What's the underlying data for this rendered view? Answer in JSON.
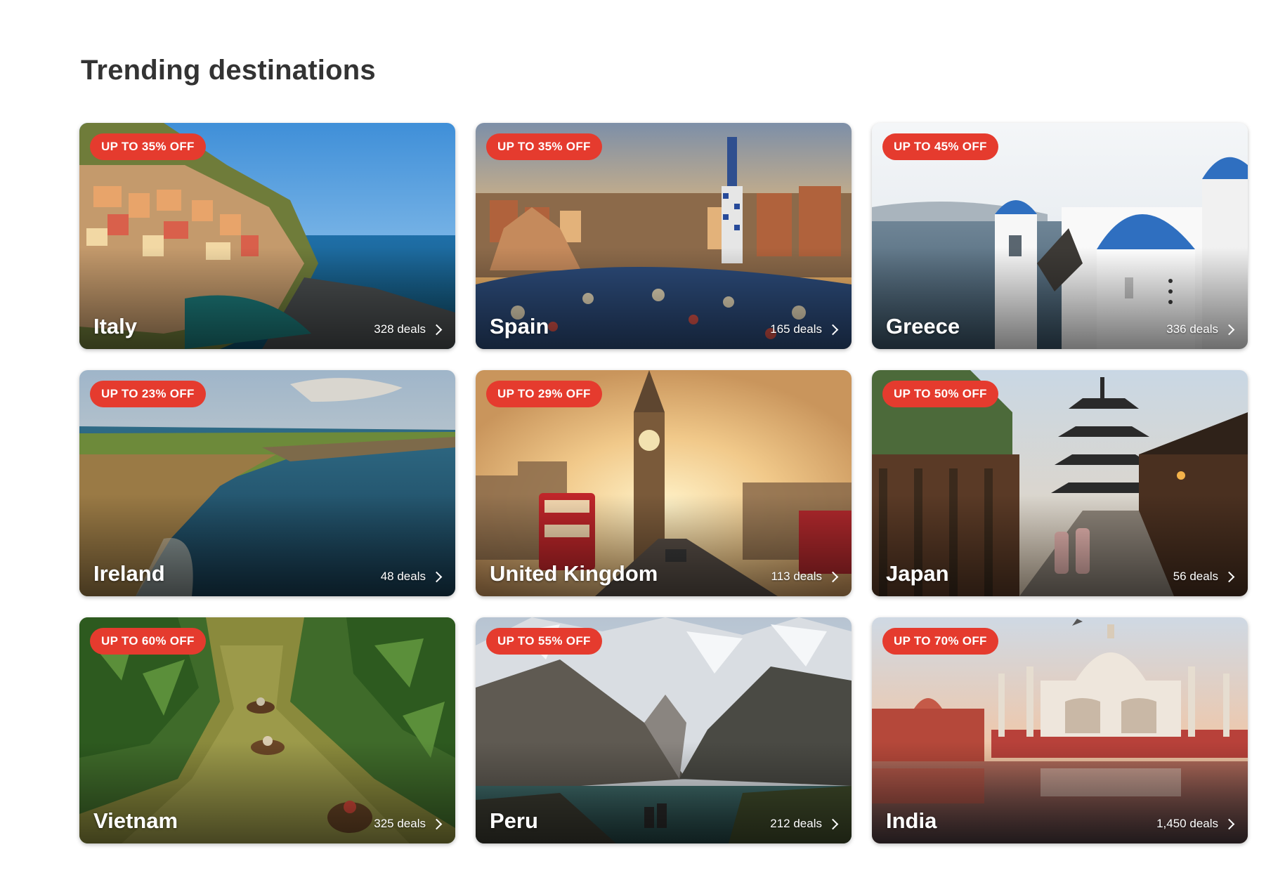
{
  "section": {
    "title": "Trending destinations"
  },
  "destinations": [
    {
      "name": "Italy",
      "badge": "UP TO 35% OFF",
      "deals": "328 deals",
      "scene": "coastal-village-image"
    },
    {
      "name": "Spain",
      "badge": "UP TO 35% OFF",
      "deals": "165 deals",
      "scene": "city-mosaic-image"
    },
    {
      "name": "Greece",
      "badge": "UP TO 45% OFF",
      "deals": "336 deals",
      "scene": "blue-dome-image"
    },
    {
      "name": "Ireland",
      "badge": "UP TO 23% OFF",
      "deals": "48 deals",
      "scene": "sea-cliffs-image"
    },
    {
      "name": "United Kingdom",
      "badge": "UP TO 29% OFF",
      "deals": "113 deals",
      "scene": "clock-tower-image"
    },
    {
      "name": "Japan",
      "badge": "UP TO 50% OFF",
      "deals": "56 deals",
      "scene": "pagoda-street-image"
    },
    {
      "name": "Vietnam",
      "badge": "UP TO 60% OFF",
      "deals": "325 deals",
      "scene": "jungle-river-image"
    },
    {
      "name": "Peru",
      "badge": "UP TO 55% OFF",
      "deals": "212 deals",
      "scene": "mountain-lake-image"
    },
    {
      "name": "India",
      "badge": "UP TO 70% OFF",
      "deals": "1,450 deals",
      "scene": "palace-reflection-image"
    }
  ],
  "colors": {
    "badge": "#e53b2e",
    "title": "#333333"
  }
}
